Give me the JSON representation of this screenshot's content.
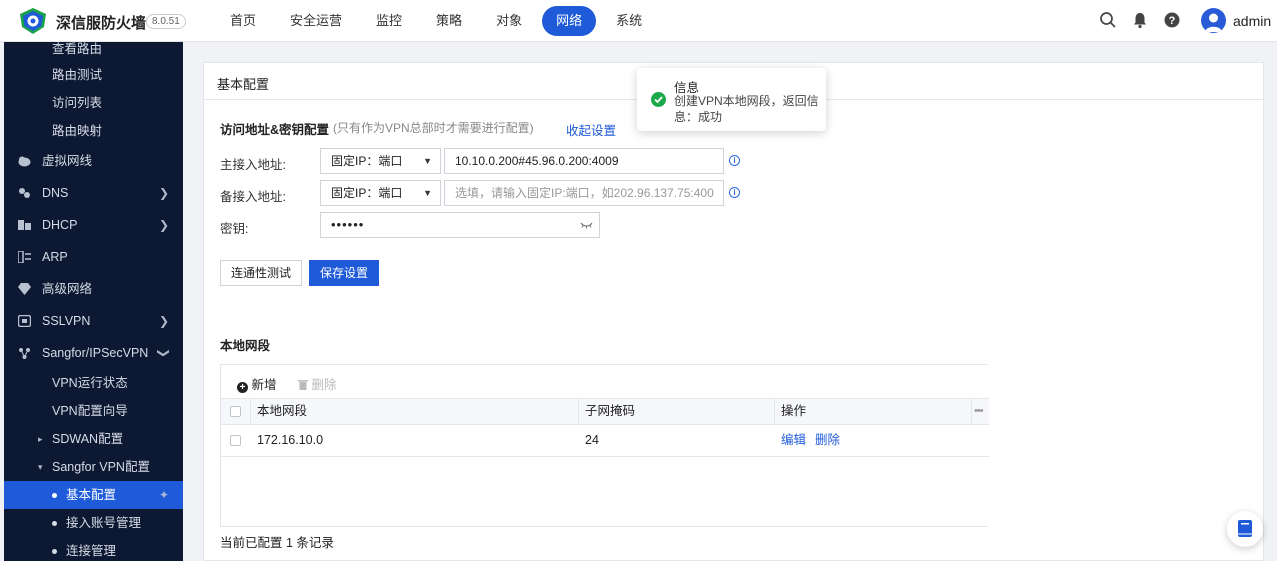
{
  "header": {
    "brand": "深信服防火墙",
    "version": "8.0.51",
    "nav": [
      "首页",
      "安全运营",
      "监控",
      "策略",
      "对象",
      "网络",
      "系统"
    ],
    "active_nav": "网络",
    "user": "admin",
    "icons": [
      "search-icon",
      "bell-icon",
      "help-icon",
      "avatar"
    ]
  },
  "sidebar": {
    "items": [
      {
        "label": "查看路由"
      },
      {
        "label": "路由测试"
      },
      {
        "label": "访问列表"
      },
      {
        "label": "路由映射"
      },
      {
        "label": "虚拟网线"
      },
      {
        "label": "DNS"
      },
      {
        "label": "DHCP"
      },
      {
        "label": "ARP"
      },
      {
        "label": "高级网络"
      },
      {
        "label": "SSLVPN"
      },
      {
        "label": "Sangfor/IPSecVPN"
      },
      {
        "label": "VPN运行状态"
      },
      {
        "label": "VPN配置向导"
      },
      {
        "label": "SDWAN配置"
      },
      {
        "label": "Sangfor VPN配置"
      },
      {
        "label": "基本配置"
      },
      {
        "label": "接入账号管理"
      },
      {
        "label": "连接管理"
      }
    ]
  },
  "main": {
    "panel_title": "基本配置",
    "section": {
      "title": "访问地址&密钥配置",
      "note": "(只有作为VPN总部时才需要进行配置)",
      "collapse_link": "收起设置"
    },
    "form": {
      "primary_label": "主接入地址:",
      "primary_type": "固定IP：端口",
      "primary_value": "10.10.0.200#45.96.0.200:4009",
      "backup_label": "备接入地址:",
      "backup_type": "固定IP：端口",
      "backup_placeholder": "选填，请输入固定IP:端口，如202.96.137.75:400",
      "key_label": "密钥:",
      "key_value": "••••••"
    },
    "buttons": {
      "test": "连通性测试",
      "save": "保存设置"
    },
    "local_net": {
      "title": "本地网段",
      "add": "新增",
      "delete": "删除",
      "columns": [
        "本地网段",
        "子网掩码",
        "操作"
      ],
      "rows": [
        {
          "network": "172.16.10.0",
          "mask": "24",
          "edit": "编辑",
          "delete": "删除"
        }
      ],
      "footer": "当前已配置 1 条记录"
    }
  },
  "toast": {
    "title": "信息",
    "message": "创建VPN本地网段，返回信息：成功"
  }
}
